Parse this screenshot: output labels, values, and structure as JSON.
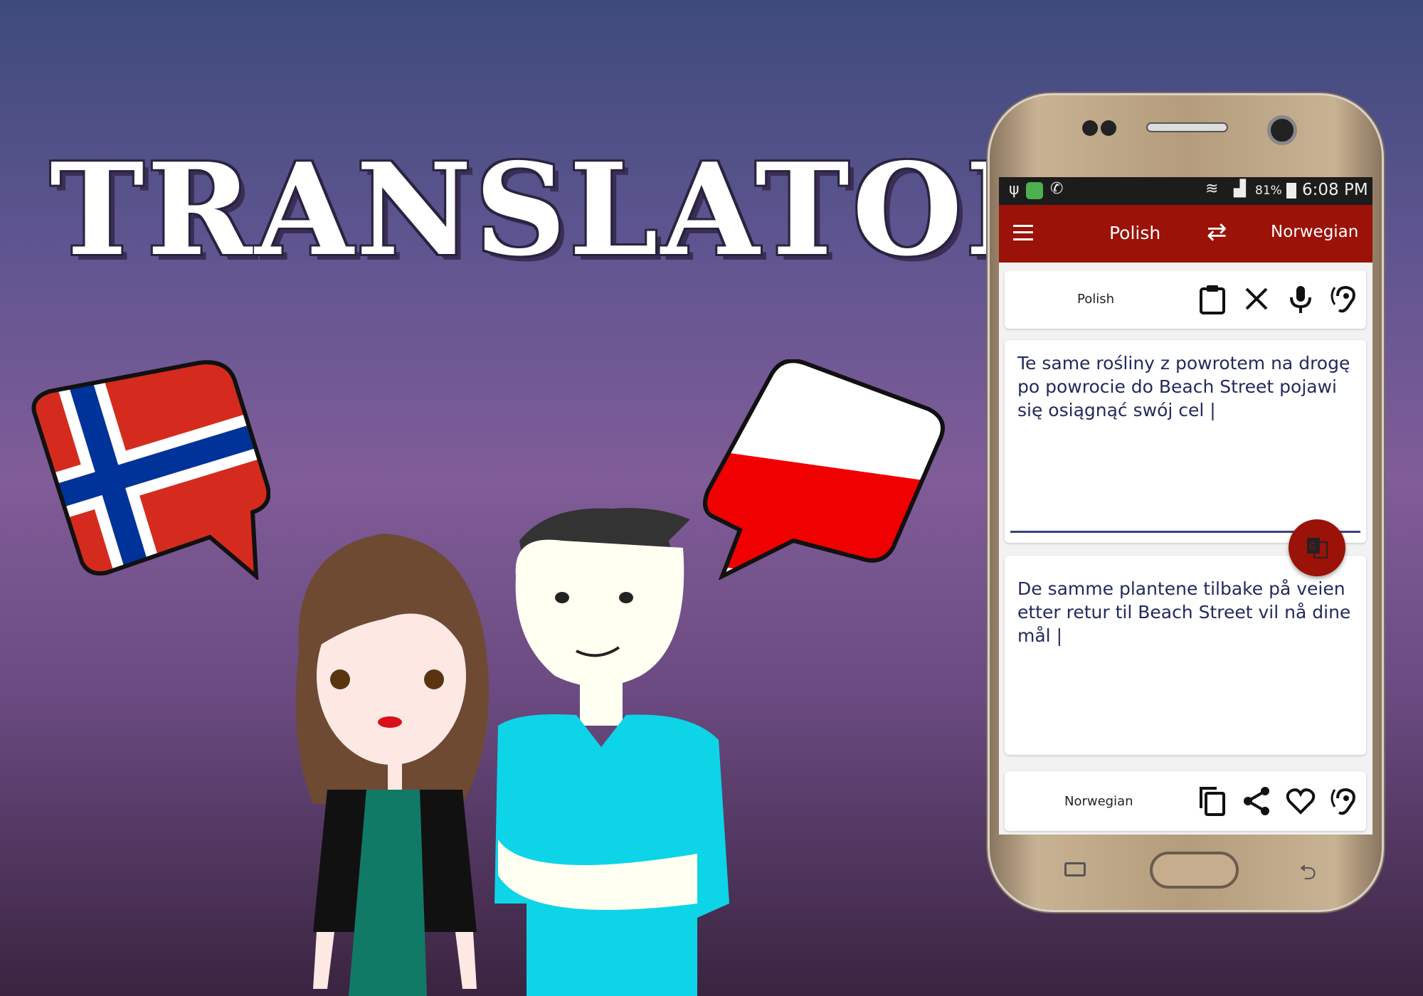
{
  "banner": {
    "title": "TRANSLATOR"
  },
  "status_bar": {
    "battery": "81%",
    "time": "6:08 PM"
  },
  "app_bar": {
    "source_language": "Polish",
    "target_language": "Norwegian",
    "menu_icon": "hamburger-icon",
    "swap_icon": "swap-arrows-icon"
  },
  "source_panel": {
    "label": "Polish",
    "icons": [
      "clipboard-icon",
      "close-icon",
      "microphone-icon",
      "listen-ear-icon"
    ]
  },
  "input": {
    "text": "Te same rośliny z powrotem na drogę po powrocie do Beach Street pojawi się osiągnąć swój cel |"
  },
  "translate_button": {
    "icon": "google-translate-icon"
  },
  "output": {
    "text": "De samme plantene tilbake på veien etter retur til Beach Street vil nå dine mål |"
  },
  "target_panel": {
    "label": "Norwegian",
    "icons": [
      "copy-icon",
      "share-icon",
      "heart-icon",
      "listen-ear-icon"
    ]
  },
  "colors": {
    "app_bar": "#9b1208",
    "text": "#232a5c",
    "status_bar": "#1c1c1c"
  }
}
